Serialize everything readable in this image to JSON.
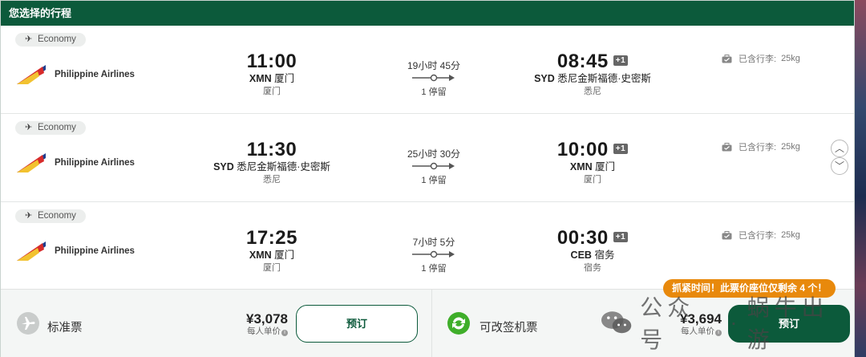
{
  "header": {
    "title": "您选择的行程"
  },
  "flights": [
    {
      "cabin": "Economy",
      "airline": "Philippine Airlines",
      "dep_time": "11:00",
      "dep_code": "XMN",
      "dep_airport": "厦门",
      "dep_city": "厦门",
      "duration": "19小时 45分",
      "stops": "1 停留",
      "arr_time": "08:45",
      "arr_plus": "+1",
      "arr_code": "SYD",
      "arr_airport": "悉尼金斯福德·史密斯",
      "arr_city": "悉尼",
      "baggage_label": "已含行李:",
      "baggage_value": "25kg"
    },
    {
      "cabin": "Economy",
      "airline": "Philippine Airlines",
      "dep_time": "11:30",
      "dep_code": "SYD",
      "dep_airport": "悉尼金斯福德·史密斯",
      "dep_city": "悉尼",
      "duration": "25小时 30分",
      "stops": "1 停留",
      "arr_time": "10:00",
      "arr_plus": "+1",
      "arr_code": "XMN",
      "arr_airport": "厦门",
      "arr_city": "厦门",
      "baggage_label": "已含行李:",
      "baggage_value": "25kg"
    },
    {
      "cabin": "Economy",
      "airline": "Philippine Airlines",
      "dep_time": "17:25",
      "dep_code": "XMN",
      "dep_airport": "厦门",
      "dep_city": "厦门",
      "duration": "7小时 5分",
      "stops": "1 停留",
      "arr_time": "00:30",
      "arr_plus": "+1",
      "arr_code": "CEB",
      "arr_airport": "宿务",
      "arr_city": "宿务",
      "baggage_label": "已含行李:",
      "baggage_value": "25kg"
    }
  ],
  "fares": [
    {
      "label": "标准票",
      "price": "¥3,078",
      "price_note": "每人单价",
      "button": "预订",
      "icon": "airplane-circle-icon"
    },
    {
      "label": "可改签机票",
      "price": "¥3,694",
      "price_note": "每人单价",
      "button": "预订",
      "icon": "refresh-circle-icon"
    }
  ],
  "urgent_banner": "抓紧时间！此票价座位仅剩余 4 个！",
  "watermark": {
    "left": "公众号",
    "right": "蜗牛出游"
  },
  "scroll": {
    "up": "︿",
    "down": "﹀"
  },
  "colors": {
    "brand": "#0c5a3b",
    "urgent": "#e8890c"
  }
}
